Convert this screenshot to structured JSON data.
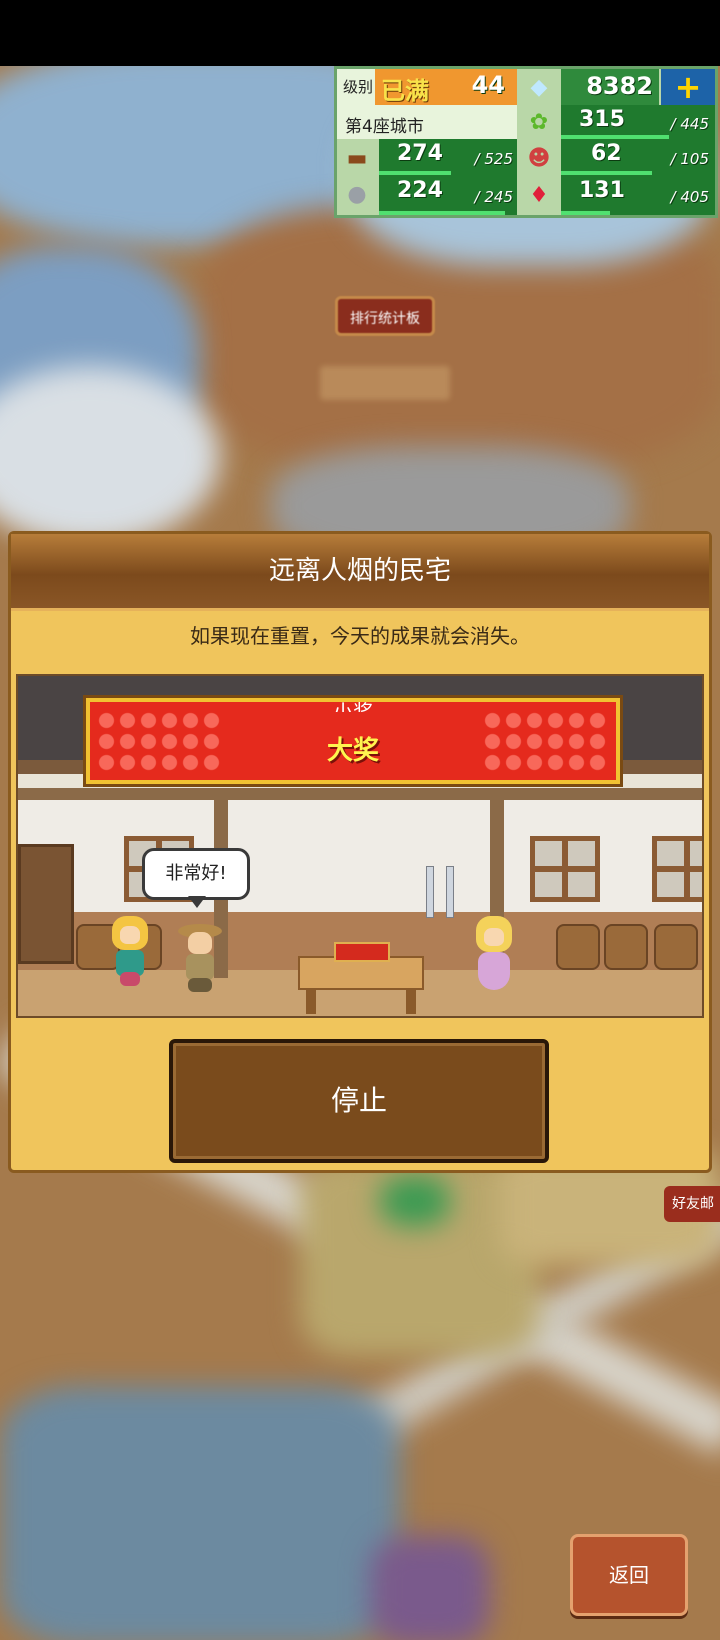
{
  "hud": {
    "level_label": "级别",
    "level_status": "已满",
    "level_value": "44",
    "gems": "8382",
    "city_name": "第4座城市",
    "food": {
      "value": "315",
      "max": "/ 445"
    },
    "wood": {
      "value": "274",
      "max": "/ 525"
    },
    "people": {
      "value": "62",
      "max": "/ 105"
    },
    "stone": {
      "value": "224",
      "max": "/ 245"
    },
    "ruby": {
      "value": "131",
      "max": "/ 405"
    },
    "colors": {
      "panel": "#b9d7a8",
      "bar": "#1f7a2e",
      "accent": "#f0972f"
    }
  },
  "map": {
    "rank_board_label": "排行统计板"
  },
  "dialog": {
    "title": "远离人烟的民宅",
    "message": "如果现在重置，今天的成果就会消失。",
    "banner_prev": "小奖",
    "banner_current": "大奖",
    "speech": "非常好!",
    "stop_label": "停止"
  },
  "friend_tab_label": "好友邮",
  "back_label": "返回"
}
